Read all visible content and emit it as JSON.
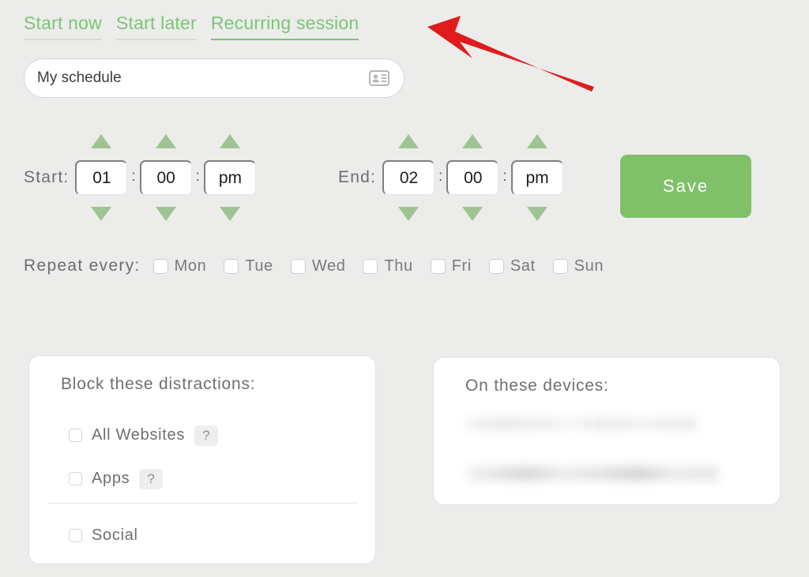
{
  "tabs": [
    {
      "label": "Start now",
      "active": false
    },
    {
      "label": "Start later",
      "active": false
    },
    {
      "label": "Recurring session",
      "active": true
    }
  ],
  "schedule_name": {
    "value": "My schedule",
    "placeholder": "My schedule",
    "icon": "contact-card-icon"
  },
  "time": {
    "start_label": "Start:",
    "end_label": "End:",
    "separator": ":",
    "start": {
      "hour": "01",
      "minute": "00",
      "meridiem": "pm"
    },
    "end": {
      "hour": "02",
      "minute": "00",
      "meridiem": "pm"
    }
  },
  "save_button": {
    "label": "Save"
  },
  "repeat": {
    "label": "Repeat every:",
    "days": [
      {
        "label": "Mon",
        "checked": false
      },
      {
        "label": "Tue",
        "checked": false
      },
      {
        "label": "Wed",
        "checked": false
      },
      {
        "label": "Thu",
        "checked": false
      },
      {
        "label": "Fri",
        "checked": false
      },
      {
        "label": "Sat",
        "checked": false
      },
      {
        "label": "Sun",
        "checked": false
      }
    ]
  },
  "block_card": {
    "title": "Block these distractions:",
    "items": [
      {
        "label": "All Websites",
        "checked": false,
        "help": "?"
      },
      {
        "label": "Apps",
        "checked": false,
        "help": "?"
      },
      {
        "label": "Social",
        "checked": false
      }
    ]
  },
  "devices_card": {
    "title": "On these devices:",
    "rows": [
      "",
      ""
    ]
  },
  "annotation": {
    "type": "arrow",
    "color": "#e01b1b",
    "points_to": "Recurring session"
  },
  "colors": {
    "background": "#ececeb",
    "accent_green": "#7cc576",
    "save_green": "#7fc068",
    "spinner_green": "#9fc491",
    "text_gray": "#6d6d6d",
    "card_white": "#ffffff",
    "arrow_red": "#e01b1b"
  }
}
